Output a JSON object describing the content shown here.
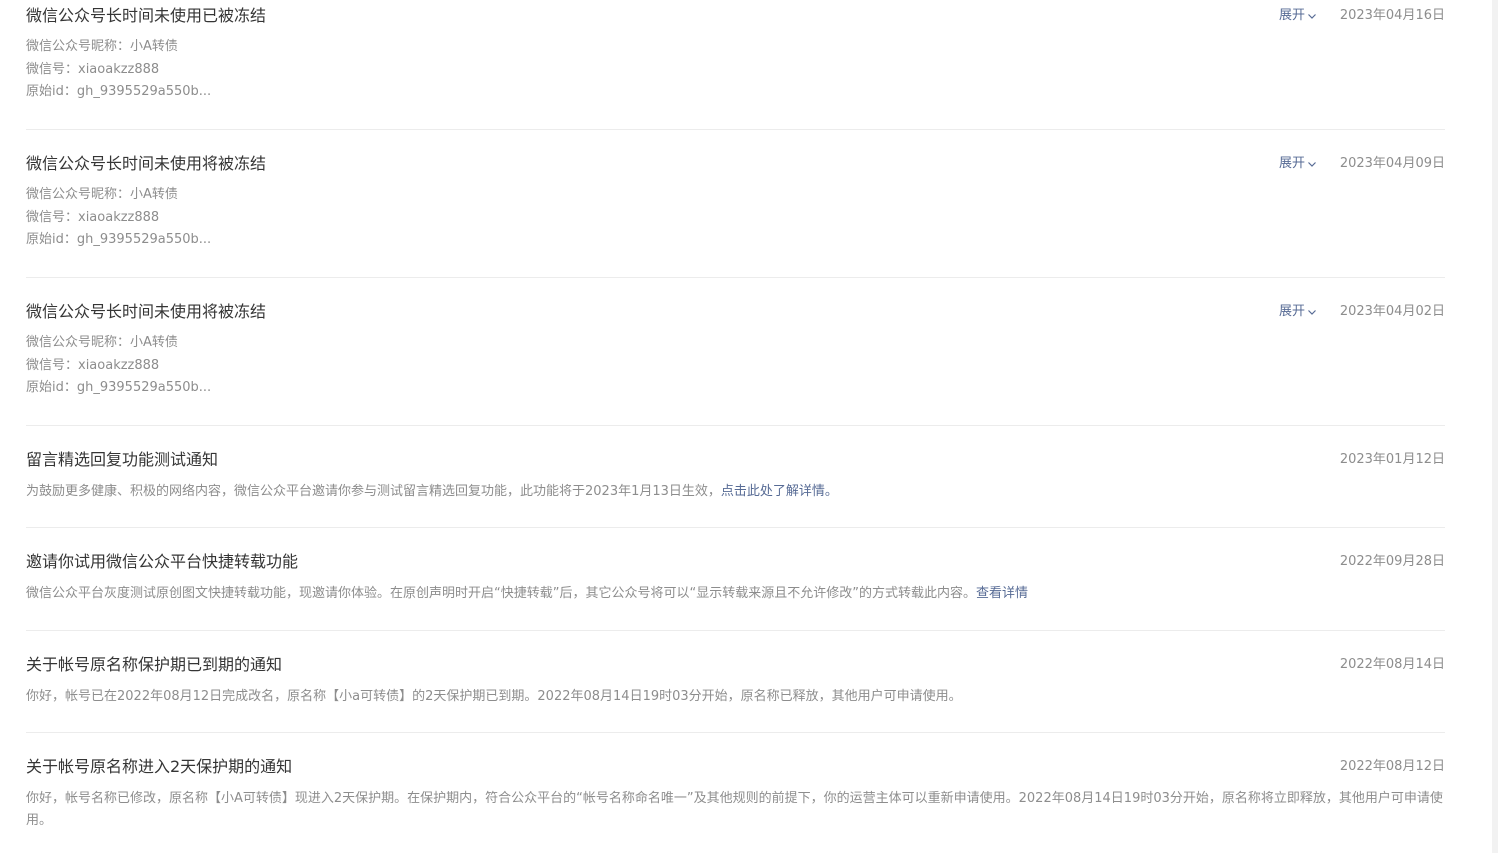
{
  "items": [
    {
      "title": "微信公众号长时间未使用已被冻结",
      "date": "2023年04月16日",
      "expand_label": "展开",
      "meta": [
        "微信公众号昵称：小A转债",
        "微信号：xiaoakzz888",
        "原始id：gh_9395529a550b..."
      ]
    },
    {
      "title": "微信公众号长时间未使用将被冻结",
      "date": "2023年04月09日",
      "expand_label": "展开",
      "meta": [
        "微信公众号昵称：小A转债",
        "微信号：xiaoakzz888",
        "原始id：gh_9395529a550b..."
      ]
    },
    {
      "title": "微信公众号长时间未使用将被冻结",
      "date": "2023年04月02日",
      "expand_label": "展开",
      "meta": [
        "微信公众号昵称：小A转债",
        "微信号：xiaoakzz888",
        "原始id：gh_9395529a550b..."
      ]
    },
    {
      "title": "留言精选回复功能测试通知",
      "date": "2023年01月12日",
      "desc": "为鼓励更多健康、积极的网络内容，微信公众平台邀请你参与测试留言精选回复功能，此功能将于2023年1月13日生效，",
      "link": "点击此处了解详情。"
    },
    {
      "title": "邀请你试用微信公众平台快捷转载功能",
      "date": "2022年09月28日",
      "desc": "微信公众平台灰度测试原创图文快捷转载功能，现邀请你体验。在原创声明时开启“快捷转载”后，其它公众号将可以“显示转载来源且不允许修改”的方式转载此内容。",
      "link": "查看详情"
    },
    {
      "title": "关于帐号原名称保护期已到期的通知",
      "date": "2022年08月14日",
      "desc": "你好，帐号已在2022年08月12日完成改名，原名称【小a可转债】的2天保护期已到期。2022年08月14日19时03分开始，原名称已释放，其他用户可申请使用。"
    },
    {
      "title": "关于帐号原名称进入2天保护期的通知",
      "date": "2022年08月12日",
      "desc": "你好，帐号名称已修改，原名称【小A可转债】现进入2天保护期。在保护期内，符合公众平台的“帐号名称命名唯一”及其他规则的前提下，你的运营主体可以重新申请使用。2022年08月14日19时03分开始，原名称将立即释放，其他用户可申请使用。"
    }
  ]
}
